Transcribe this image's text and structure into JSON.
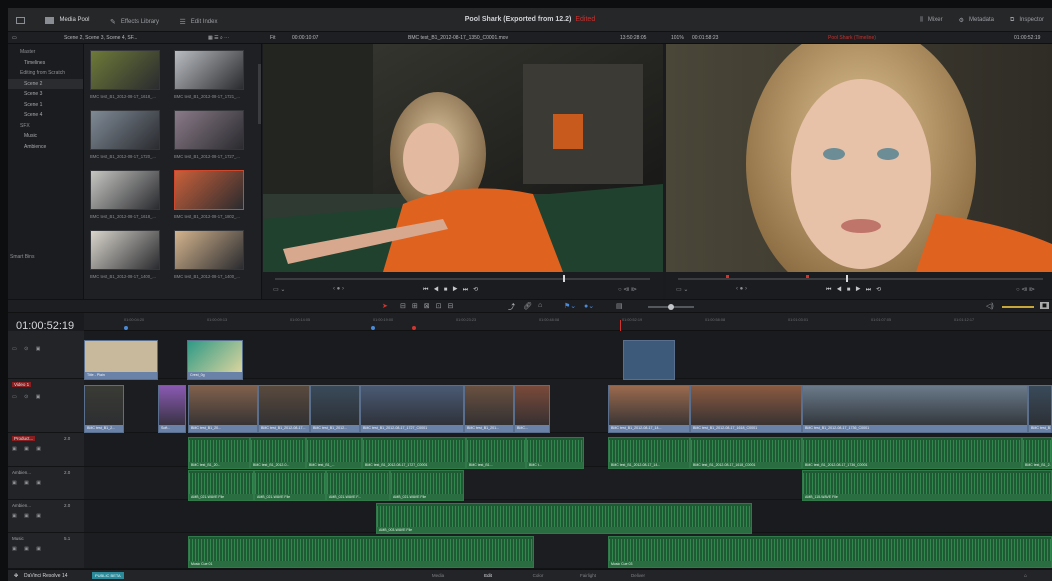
{
  "app": {
    "title": "Pool Shark (Exported from 12.2)",
    "title_status": "Edited",
    "name": "DaVinci Resolve 14",
    "badge": "PUBLIC BETA"
  },
  "topbar": {
    "media_pool": "Media Pool",
    "effects_library": "Effects Library",
    "edit_index": "Edit Index",
    "mixer": "Mixer",
    "metadata": "Metadata",
    "inspector": "Inspector"
  },
  "bar2": {
    "bin_path": "Scene 2, Scene 3, Scene 4, SF...",
    "fit": "Fit",
    "src_tc": "00:00:10:07",
    "clip_name": "BMC test_B1_2012-08-17_1350_C0001.mov",
    "src_dur": "13:50:28:05",
    "zoom": "101%",
    "rec_tc": "00:01:58:23",
    "timeline_name": "Pool Shark (Timeline)",
    "rec_dur": "01:00:52:19"
  },
  "bins": {
    "items": [
      {
        "label": "Master",
        "sub": false
      },
      {
        "label": "Timelines",
        "sub": true
      },
      {
        "label": "Editing from Scratch",
        "sub": false
      },
      {
        "label": "Scene 2",
        "sub": true,
        "selected": true
      },
      {
        "label": "Scene 3",
        "sub": true
      },
      {
        "label": "Scene 1",
        "sub": true
      },
      {
        "label": "Scene 4",
        "sub": true
      },
      {
        "label": "SFX",
        "sub": false
      },
      {
        "label": "Music",
        "sub": true
      },
      {
        "label": "Ambience",
        "sub": true
      }
    ],
    "smart_bins": "Smart Bins"
  },
  "pool": {
    "clips": [
      {
        "caption": "BMC test_B1_2012-08-17_1618_..."
      },
      {
        "caption": "BMC test_B1_2012-08-17_1721_..."
      },
      {
        "caption": "BMC test_B1_2012-08-17_1720_..."
      },
      {
        "caption": "BMC test_B1_2012-08-17_1727_..."
      },
      {
        "caption": "BMC test_B1_2012-08-17_1618_..."
      },
      {
        "caption": "BMC test_B1_2012-08-17_1802_..."
      },
      {
        "caption": "BMC test_B1_2012-08-17_1400_..."
      },
      {
        "caption": "BMC test_B1_2012-08-17_1400_..."
      }
    ]
  },
  "timeline": {
    "timecode": "01:00:52:19",
    "ruler_ticks": [
      "01:00:04:20",
      "01:00:09:13",
      "01:00:14:05",
      "01:00:19:00",
      "01:00:23:23",
      "01:00:48:08",
      "01:00:52:19",
      "01:00:58:08",
      "01:01:03:01",
      "01:01:07:05",
      "01:01:12:17"
    ],
    "tracks": {
      "v1": "Video 1",
      "a1": "Product...",
      "a1_ch": "2.0",
      "a2": "Ambien...",
      "a2_ch": "2.0",
      "a3": "Ambien...",
      "a3_ch": "2.0",
      "a4": "Music",
      "a4_ch": "5.1"
    },
    "v2_clips": [
      "Title - Plain",
      "Crest_0g"
    ],
    "v1_clips": [
      "BMC test_B1_2...",
      "Soft...",
      "BMC test_B1_20...",
      "BMC test_B1_2012-08-17...",
      "BMC test_B1_2012...",
      "BMC test_B1_2012-08-17_1727_C0001",
      "BMC test_B1_201...",
      "BMC...",
      "BMC test_B1_2012-08-17_14...",
      "BMC test_B1_2012-08-17_1618_C0001",
      "BMC test_B1_2012-08-17_1736_C0001",
      "BMC test_B1_..."
    ],
    "a1_clips": [
      "BMC test_B1_20...",
      "BMC test_B1_2012-0...",
      "BMC test_B1_...",
      "BMC test_B1_2012-08-17_1727_C0001",
      "BMC test_B1...",
      "BMC t...",
      "BMC test_B1_2012-08-17_14...",
      "BMC test_B1_2012-08-17_1618_C0001",
      "BMC test_B1_2012-08-17_1736_C0001",
      "BMC test_B1_2..."
    ],
    "a2_clips": [
      "AMB_021-WAVE File",
      "AMB_021-WAVE File",
      "AMB_021-WAVE F...",
      "AMB_021-WAVE File",
      "AMB_115-WAVE File"
    ],
    "a3_clips": [
      "AMB_003-WAVE File"
    ],
    "a4_clips": [
      "Music Cue 01",
      "Music Cue 03"
    ]
  },
  "pages": [
    "Media",
    "Edit",
    "Color",
    "Fairlight",
    "Deliver"
  ]
}
